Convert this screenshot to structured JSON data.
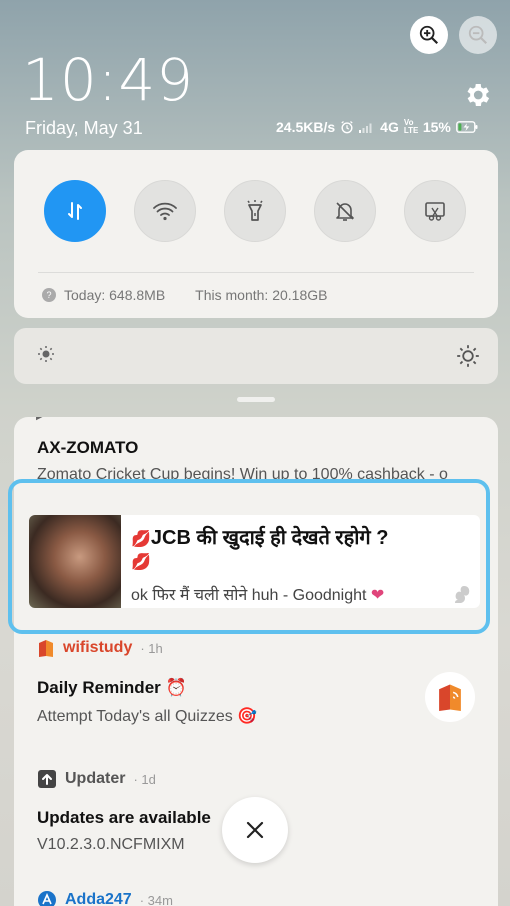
{
  "status_bar": {
    "time": "10:49",
    "date": "Friday, May 31",
    "net_speed": "24.5KB/s",
    "network": "4G",
    "volte": "Vo LTE",
    "battery": "15%"
  },
  "quick_settings": {
    "toggles": [
      {
        "name": "Mobile data",
        "icon": "data-transfer-icon",
        "active": true
      },
      {
        "name": "Wi-Fi",
        "icon": "wifi-icon",
        "active": false
      },
      {
        "name": "Flashlight",
        "icon": "flashlight-icon",
        "active": false
      },
      {
        "name": "Silent",
        "icon": "bell-off-icon",
        "active": false
      },
      {
        "name": "Screenshot",
        "icon": "screenshot-icon",
        "active": false
      }
    ],
    "data_today": "Today: 648.8MB",
    "data_month": "This month: 20.18GB"
  },
  "notifications": {
    "zomato": {
      "title": "AX-ZOMATO",
      "text": "Zomato Cricket Cup begins! Win up to 100% cashback - o"
    },
    "jcb": {
      "title": "JCB की खुदाई ही देखते रहोगे ?",
      "text": "ok फिर मैं चली सोने huh - Goodnight"
    },
    "wifistudy": {
      "app": "wifistudy",
      "time": "· 1h",
      "title": "Daily Reminder",
      "text": "Attempt Today's all Quizzes"
    },
    "updater": {
      "app": "Updater",
      "time": "· 1d",
      "title": "Updates are available",
      "text": "V10.2.3.0.NCFMIXM"
    },
    "adda": {
      "app": "Adda247",
      "time": "· 34m"
    }
  },
  "colors": {
    "accent": "#2196f3",
    "highlight": "#5ec0ee",
    "wifistudy": "#d9462b",
    "adda": "#1a73c9"
  }
}
